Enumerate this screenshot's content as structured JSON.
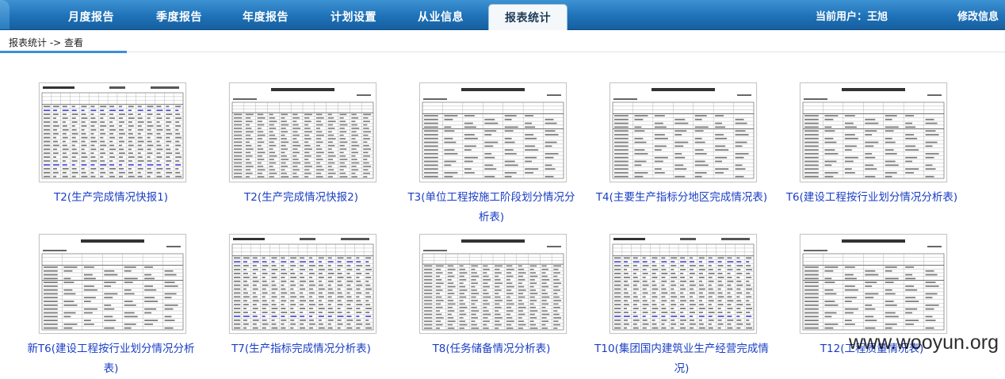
{
  "nav": {
    "tabs": [
      {
        "label": "月度报告",
        "active": false
      },
      {
        "label": "季度报告",
        "active": false
      },
      {
        "label": "年度报告",
        "active": false
      },
      {
        "label": "计划设置",
        "active": false
      },
      {
        "label": "从业信息",
        "active": false
      },
      {
        "label": "报表统计",
        "active": true
      }
    ],
    "current_user": "当前用户：王旭",
    "edit_label": "修改信息"
  },
  "breadcrumb": "报表统计 -> 查看",
  "reports": [
    {
      "label": "T2(生产完成情况快报1)",
      "style": "grid"
    },
    {
      "label": "T2(生产完成情况快报2)",
      "style": "header"
    },
    {
      "label": "T3(单位工程按施工阶段划分情况分析表)",
      "style": "sparse"
    },
    {
      "label": "T4(主要生产指标分地区完成情况表)",
      "style": "sparse"
    },
    {
      "label": "T6(建设工程按行业划分情况分析表)",
      "style": "sparse"
    },
    {
      "label": "新T6(建设工程按行业划分情况分析表)",
      "style": "sparse"
    },
    {
      "label": "T7(生产指标完成情况分析表)",
      "style": "grid"
    },
    {
      "label": "T8(任务储备情况分析表)",
      "style": "header"
    },
    {
      "label": "T10(集团国内建筑业生产经营完成情况)",
      "style": "grid"
    },
    {
      "label": "T12(工程质量情况表)",
      "style": "sparse"
    }
  ],
  "watermark": "www.wooyun.org",
  "colors": {
    "nav_bg": "#1f72b8",
    "link": "#1a3ec4",
    "accent": "#3f8fd2"
  }
}
